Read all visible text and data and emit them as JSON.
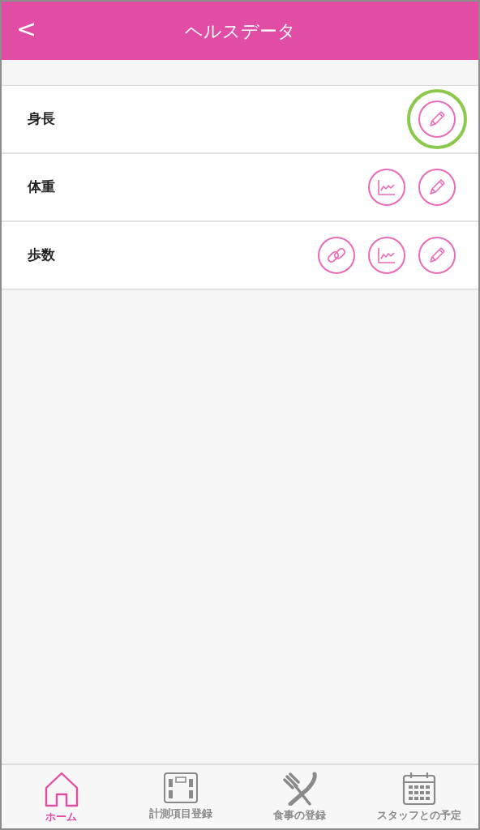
{
  "header": {
    "back": "<",
    "title": "ヘルスデータ"
  },
  "rows": [
    {
      "label": "身長",
      "actions": [
        {
          "kind": "edit",
          "highlighted": true
        }
      ]
    },
    {
      "label": "体重",
      "actions": [
        {
          "kind": "chart",
          "highlighted": false
        },
        {
          "kind": "edit",
          "highlighted": false
        }
      ]
    },
    {
      "label": "歩数",
      "actions": [
        {
          "kind": "link",
          "highlighted": false
        },
        {
          "kind": "chart",
          "highlighted": false
        },
        {
          "kind": "edit",
          "highlighted": false
        }
      ]
    }
  ],
  "tab_bar": [
    {
      "kind": "home",
      "label": "ホーム",
      "selected": true
    },
    {
      "kind": "scale",
      "label": "計測項目登録",
      "selected": false
    },
    {
      "kind": "meal",
      "label": "食事の登録",
      "selected": false
    },
    {
      "kind": "calendar",
      "label": "スタッフとの予定",
      "selected": false
    }
  ]
}
